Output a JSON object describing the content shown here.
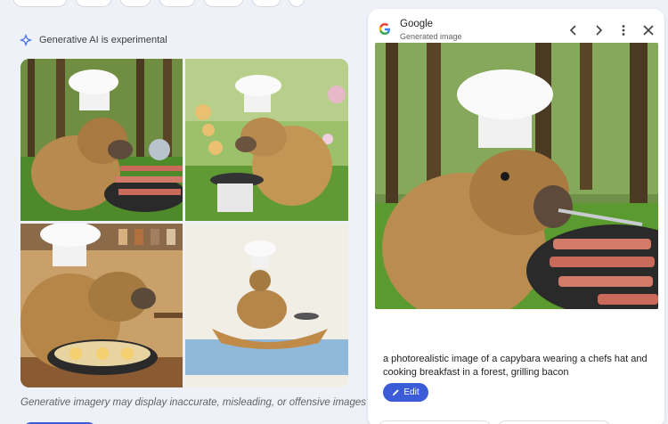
{
  "left": {
    "experimental_label": "Generative AI is experimental",
    "disclaimer": "Generative imagery may display inaccurate, misleading, or offensive images that do"
  },
  "panel": {
    "source_name": "Google",
    "source_sub": "Generated image",
    "caption": "a photorealistic image of a capybara wearing a chefs hat and cooking breakfast in a forest, grilling bacon",
    "edit_label": "Edit"
  },
  "colors": {
    "accent": "#3c5bd6",
    "gem": "#4a6fe8"
  },
  "icons": [
    "gemini-sparkle-icon",
    "google-g-icon",
    "chevron-left-icon",
    "chevron-right-icon",
    "more-vert-icon",
    "close-icon",
    "pencil-icon"
  ]
}
